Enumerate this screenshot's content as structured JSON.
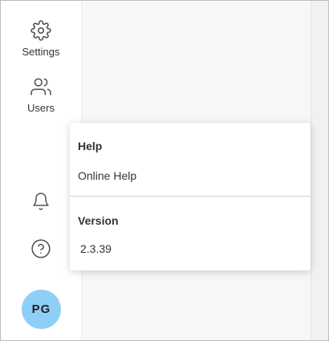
{
  "sidebar": {
    "items": [
      {
        "label": "Settings",
        "icon": "gear-icon"
      },
      {
        "label": "Users",
        "icon": "users-icon"
      }
    ],
    "bottom_icons": [
      "bell-icon",
      "help-circle-icon"
    ],
    "avatar": {
      "initials": "PG",
      "color": "#8ecff8"
    }
  },
  "popup": {
    "help_heading": "Help",
    "online_help": "Online Help",
    "version_heading": "Version",
    "version_value": "2.3.39"
  }
}
